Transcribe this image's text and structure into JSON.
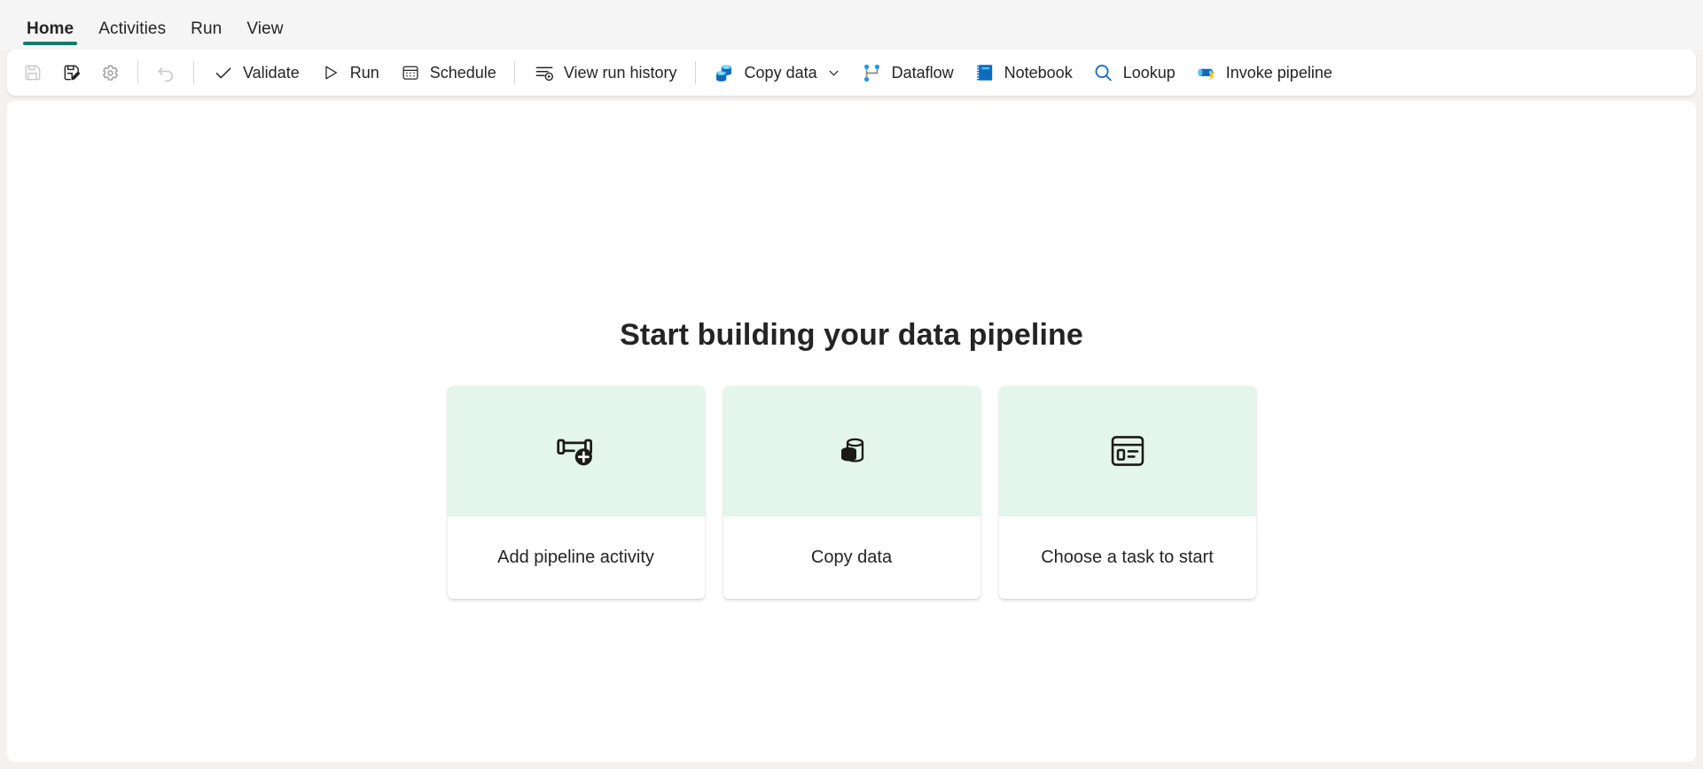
{
  "ribbon": {
    "tabs": [
      {
        "id": "home",
        "label": "Home",
        "active": true
      },
      {
        "id": "activities",
        "label": "Activities",
        "active": false
      },
      {
        "id": "run",
        "label": "Run",
        "active": false
      },
      {
        "id": "view",
        "label": "View",
        "active": false
      }
    ]
  },
  "toolbar": {
    "save_label": "Save",
    "save_as_label": "Save as",
    "settings_label": "Settings",
    "undo_label": "Undo",
    "validate_label": "Validate",
    "run_label": "Run",
    "schedule_label": "Schedule",
    "view_run_history_label": "View run history",
    "copy_data_label": "Copy data",
    "dataflow_label": "Dataflow",
    "notebook_label": "Notebook",
    "lookup_label": "Lookup",
    "invoke_pipeline_label": "Invoke pipeline"
  },
  "canvas": {
    "headline": "Start building your data pipeline",
    "cards": [
      {
        "id": "add-pipeline-activity",
        "label": "Add pipeline activity",
        "icon": "pipeline-add-icon"
      },
      {
        "id": "copy-data",
        "label": "Copy data",
        "icon": "database-copy-icon"
      },
      {
        "id": "choose-a-task-to-start",
        "label": "Choose a task to start",
        "icon": "task-template-icon"
      }
    ]
  },
  "colors": {
    "accent_teal": "#107c6b",
    "card_art_bg": "#e3f5ec",
    "fluent_blue": "#0f6cbd",
    "icon_blue_light": "#31a8e0",
    "icon_blue_dark": "#0078d4",
    "text_primary": "#242424",
    "disabled_grey": "#bdbdbd",
    "canvas_bg": "#ffffff",
    "shell_bg": "#f5f5f5"
  }
}
